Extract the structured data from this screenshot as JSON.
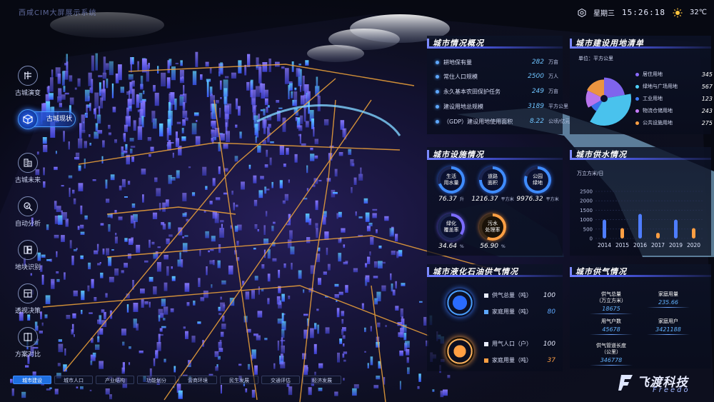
{
  "app": {
    "title": "西咸CIM大屏展示系统"
  },
  "topbar": {
    "weekday": "星期三",
    "time": "15:26:18",
    "temperature": "32℃",
    "settings_icon": "settings-icon",
    "weather_icon": "sun-icon"
  },
  "nav": {
    "items": [
      {
        "label": "古城演变",
        "icon": "city-evolution-icon"
      },
      {
        "label": "古城现状",
        "icon": "cube-icon",
        "active": true
      },
      {
        "label": "古城未来",
        "icon": "buildings-icon"
      },
      {
        "label": "自动分析",
        "icon": "search-analysis-icon"
      },
      {
        "label": "地块识别",
        "icon": "blocks-icon"
      },
      {
        "label": "透视决策",
        "icon": "layers-icon"
      },
      {
        "label": "方案对比",
        "icon": "compare-icon"
      }
    ]
  },
  "bottom_tabs": [
    "城市建设",
    "城市人口",
    "产业结构",
    "功能划分",
    "营商环境",
    "民生发展",
    "交通评估",
    "经济发展"
  ],
  "overview": {
    "title": "城市情况概况",
    "rows": [
      {
        "name": "耕地保有量",
        "value": "282",
        "unit": "万亩"
      },
      {
        "name": "常住人口规模",
        "value": "2500",
        "unit": "万人"
      },
      {
        "name": "永久基本农田保护任务",
        "value": "249",
        "unit": "万亩"
      },
      {
        "name": "建设用地总规模",
        "value": "3189",
        "unit": "平方公里"
      },
      {
        "name": "（GDP）建设用地使用面积",
        "value": "8.22",
        "unit": "公顷/亿元"
      }
    ]
  },
  "land_use": {
    "title": "城市建设用地清单",
    "unit_label": "单位：平方公里",
    "items": [
      {
        "name": "居住用地",
        "value": 345,
        "color": "#8a6bff"
      },
      {
        "name": "绿地与广场用地",
        "value": 567,
        "color": "#4fd1ff"
      },
      {
        "name": "工业用地",
        "value": 123,
        "color": "#3f7bff"
      },
      {
        "name": "物流仓储用地",
        "value": 243,
        "color": "#c77dff"
      },
      {
        "name": "公共设施用地",
        "value": 275,
        "color": "#ff9f43"
      }
    ]
  },
  "facilities": {
    "title": "城市设施情况",
    "items": [
      {
        "name": "生活\n用水量",
        "value": "76.37",
        "unit": "升",
        "color": "#3f8cff"
      },
      {
        "name": "道路\n面积",
        "value": "1216.37",
        "unit": "平方米",
        "color": "#3f8cff"
      },
      {
        "name": "公园\n绿地",
        "value": "9976.32",
        "unit": "平方米",
        "color": "#3f8cff"
      },
      {
        "name": "绿化\n覆盖率",
        "value": "34.64",
        "unit": "%",
        "color": "#7c6cff"
      },
      {
        "name": "污水\n处理率",
        "value": "56.90",
        "unit": "%",
        "color": "#ff9f43"
      }
    ]
  },
  "water": {
    "title": "城市供水情况",
    "ylabel": "万立方米/日",
    "chart_data": {
      "type": "bar",
      "categories": [
        "2014",
        "2015",
        "2016",
        "2017",
        "2019",
        "2020"
      ],
      "values": [
        1000,
        550,
        1300,
        300,
        1000,
        550
      ],
      "colors": [
        "#4e7dff",
        "#ff9f43",
        "#4e7dff",
        "#ff9f43",
        "#4e7dff",
        "#ff9f43"
      ],
      "ylim": [
        0,
        2500
      ],
      "yticks": [
        0,
        500,
        1000,
        1500,
        2000,
        2500
      ],
      "ylabel": "万立方米/日",
      "grid": true
    }
  },
  "lpg": {
    "title": "城市液化石油供气情况",
    "blocks": [
      {
        "rows": [
          {
            "name": "供气总量（吨）",
            "value": "100",
            "color": "#e8ecff",
            "sq": "#e8ecff"
          },
          {
            "name": "家庭用量（吨）",
            "value": "80",
            "color": "#5ea8ff",
            "sq": "#5ea8ff"
          }
        ]
      },
      {
        "rows": [
          {
            "name": "用气人口（户）",
            "value": "100",
            "color": "#e8ecff",
            "sq": "#e8ecff"
          },
          {
            "name": "家庭用量（吨）",
            "value": "37",
            "color": "#ff9f43",
            "sq": "#ff9f43"
          }
        ]
      }
    ]
  },
  "gas": {
    "title": "城市供气情况",
    "items": [
      {
        "name": "供气总量\n（万立方米）",
        "value": "18675"
      },
      {
        "name": "家庭用量",
        "value": "235.66"
      },
      {
        "name": "用气户数",
        "value": "45678"
      },
      {
        "name": "家庭用户",
        "value": "3421188"
      },
      {
        "name": "供气管道长度\n（公里）",
        "value": "346778"
      }
    ]
  },
  "logo": {
    "cn": "飞渡科技",
    "en": "Freedo"
  }
}
